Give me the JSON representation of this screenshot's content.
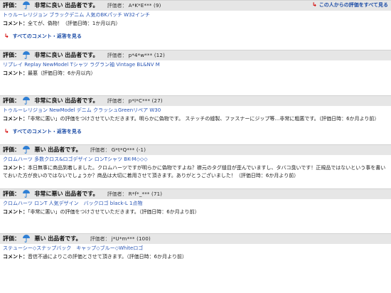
{
  "see_all_link": "この人からの評価をすべて見る",
  "reviews": [
    {
      "rating_label": "評価：",
      "eval_text": "非常に良い 出品者です。",
      "reviewer_label": "評価者：",
      "reviewer": "A*K*E*** (9)",
      "item": "トゥルーレリジョン ブラックデニム 人気のBKパッチ W32インチ",
      "comment_label": "コメント：",
      "comment": "全てが、偽物！（評価日時：1か月以内）",
      "more_link": "すべてのコメント・返答を見る"
    },
    {
      "rating_label": "評価：",
      "eval_text": "非常に良い 出品者です。",
      "reviewer_label": "評価者：",
      "reviewer": "p*4*w*** (12)",
      "item": "リプレイ Replay NewModel Tシャツ ラグラン袖 Vintage BL&NV M",
      "comment_label": "コメント：",
      "comment": "最悪（評価日時：6か月以内）"
    },
    {
      "rating_label": "評価：",
      "eval_text": "非常に良い 出品者です。",
      "reviewer_label": "評価者：",
      "reviewer": "p*I*C*** (27)",
      "item": "トゥルーレリジョン NewModel デニム クラッシュGreenリペア W30",
      "comment_label": "コメント：",
      "comment": "「非常に悪い」の評価をつけさせていただきます。明らかに偽物です。 ステッチの縫製、ファスナーにジップ等…非常に粗悪です。（評価日時：6か月より前）",
      "more_link": "すべてのコメント・返答を見る"
    },
    {
      "rating_label": "評価：",
      "eval_text": "悪い 出品者です。",
      "reviewer_label": "評価者：",
      "reviewer": "G*t*Q*** (-1)",
      "item": "クロムハーツ 多数クロス&ロゴデザイン ロンTシャツ BK-M◇◇◇",
      "comment_label": "コメント：",
      "comment": "本日無事に商品到着しました。クロムハーツですが明らかに偽物ですよね？襟元のタグ縫目が歪んでいますし、タバコ臭いです！正規品ではないという事を書いておいた方が良いのではないでしょうか？商品は大切に着用させて頂きます。ありがとうございました！（評価日時：6か月より前）"
    },
    {
      "rating_label": "評価：",
      "eval_text": "非常に悪い 出品者です。",
      "reviewer_label": "評価者：",
      "reviewer": "R*f*_*** (71)",
      "item": "クロムハーツ ロンT 人気デザイン　バックロゴ black-L 1点物",
      "comment_label": "コメント：",
      "comment": "「非常に悪い」の評価をつけさせていただきます。（評価日時：6か月より前）"
    },
    {
      "rating_label": "評価：",
      "eval_text": "悪い 出品者です。",
      "reviewer_label": "評価者：",
      "reviewer": "j*U*m*** (100)",
      "item": "ステューシー◇スナップバック　キャップ◇ブルー◇Whiteロゴ",
      "comment_label": "コメント：",
      "comment": "音信不通によりこの評価とさせて頂きます。（評価日時：6か月より前）"
    }
  ],
  "colors": {
    "header_bg": "#e6e6e6",
    "link": "#2a56b5",
    "more_link": "#1f4fa8",
    "arrow": "#d40000",
    "umbrella": "#2f7fd4"
  },
  "icons": {
    "rating": "umbrella-icon",
    "more": "return-arrow-icon"
  }
}
